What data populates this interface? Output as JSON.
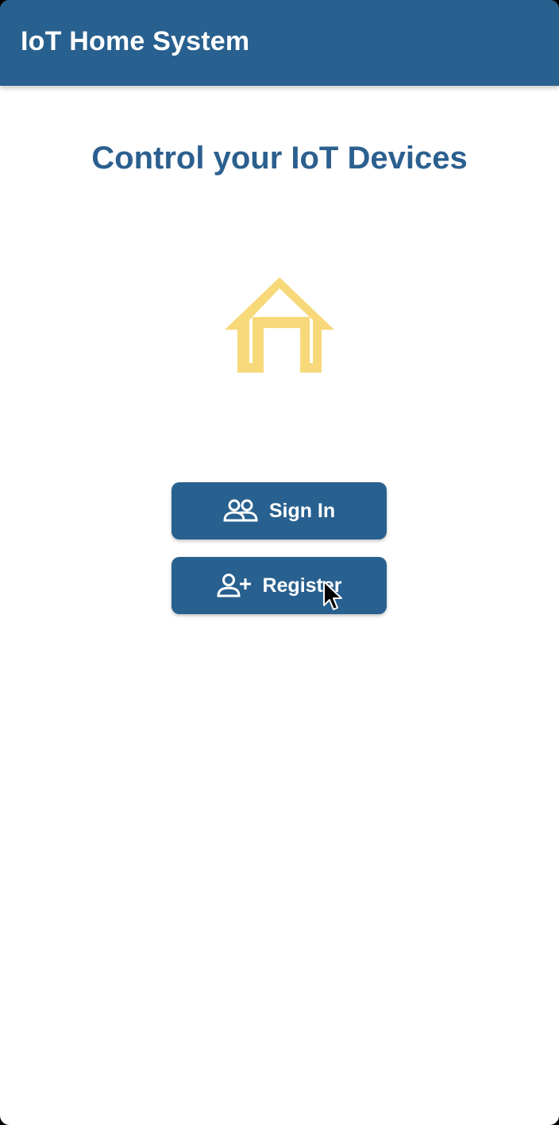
{
  "app_bar": {
    "title": "IoT Home System",
    "color": "#28608f"
  },
  "main": {
    "heading": "Control your IoT Devices",
    "hero_icon": "home-icon",
    "hero_icon_color": "#f7d97a"
  },
  "actions": {
    "sign_in": {
      "label": "Sign In",
      "icon": "people-icon"
    },
    "register": {
      "label": "Register",
      "icon": "person-add-icon"
    }
  },
  "colors": {
    "primary": "#28608f",
    "heading": "#2b5f8e",
    "accent": "#f7d97a",
    "background": "#ffffff"
  }
}
